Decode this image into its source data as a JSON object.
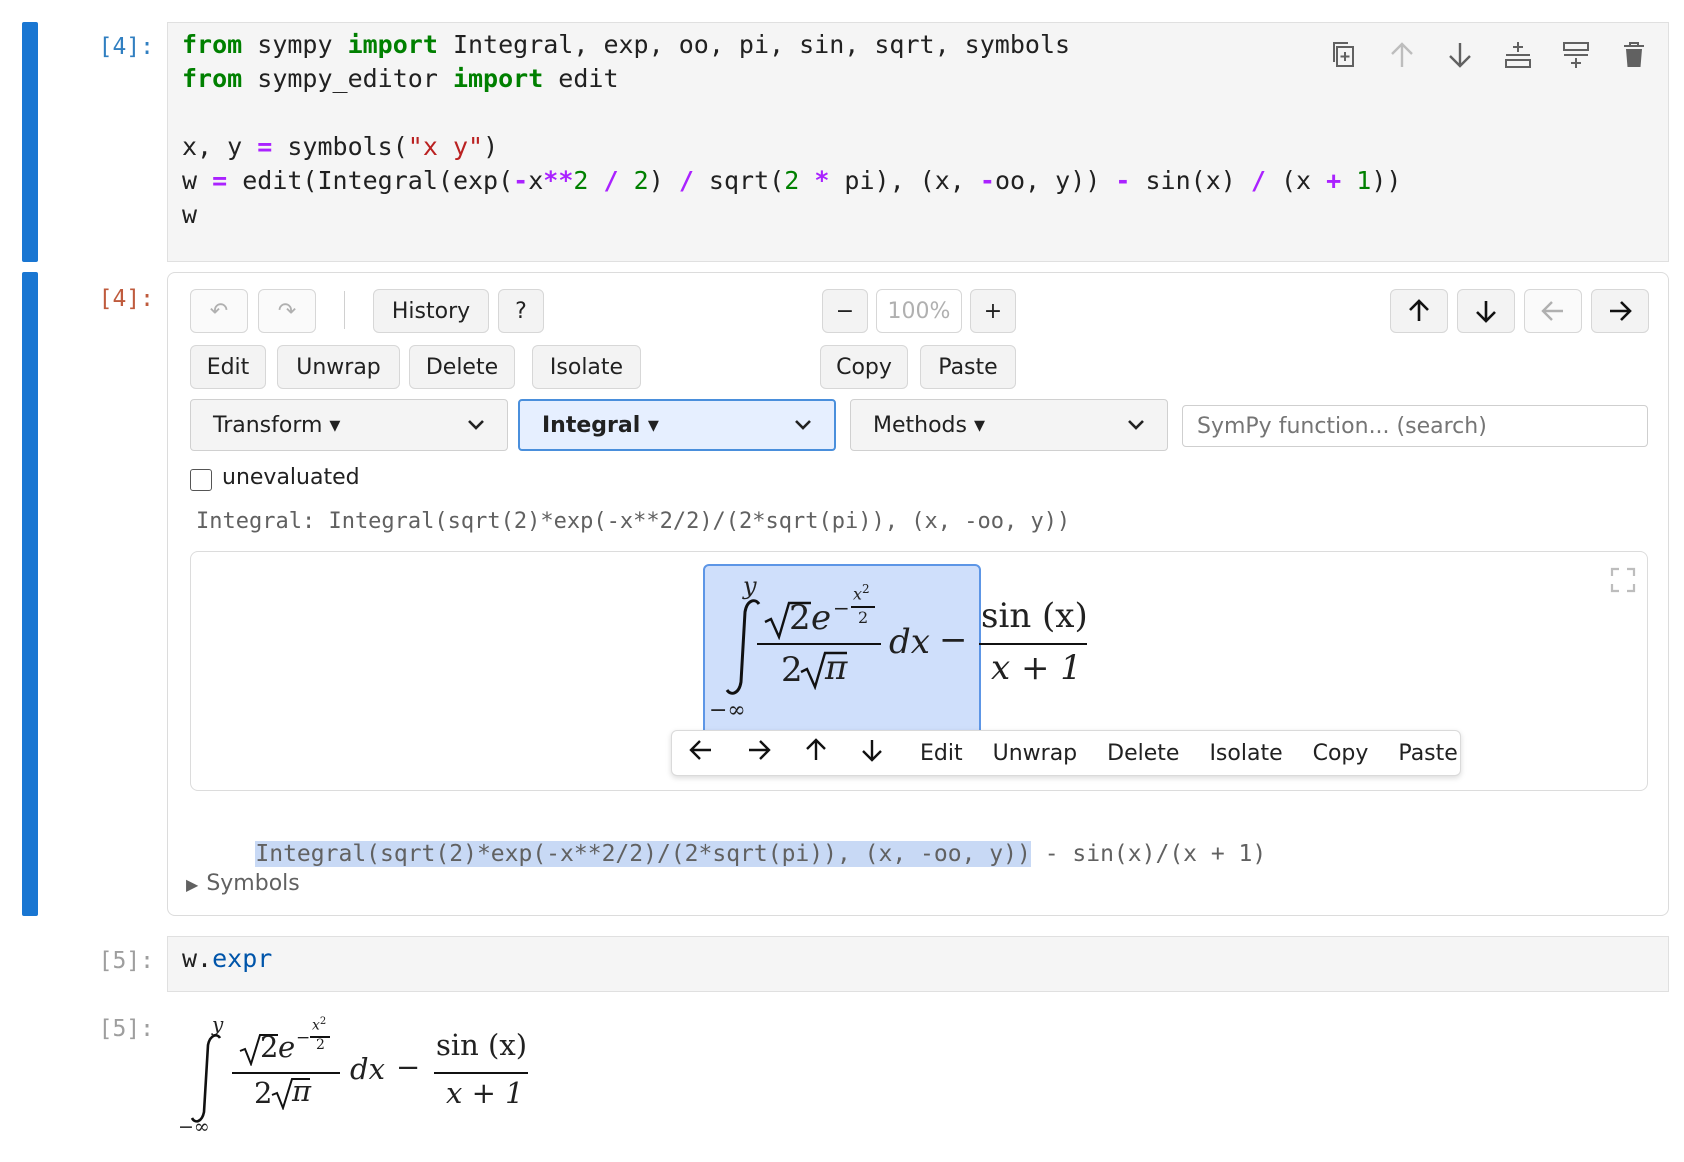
{
  "cells": [
    {
      "prompt": "[4]:",
      "code_lines": [
        [
          {
            "t": "from",
            "c": "kw"
          },
          {
            "t": " sympy "
          },
          {
            "t": "import",
            "c": "kw"
          },
          {
            "t": " Integral, exp, oo, pi, sin, sqrt, symbols"
          }
        ],
        [
          {
            "t": "from",
            "c": "kw"
          },
          {
            "t": " sympy_editor "
          },
          {
            "t": "import",
            "c": "kw"
          },
          {
            "t": " edit"
          }
        ],
        [],
        [
          {
            "t": "x, y "
          },
          {
            "t": "=",
            "c": "op"
          },
          {
            "t": " symbols("
          },
          {
            "t": "\"x y\"",
            "c": "str"
          },
          {
            "t": ")"
          }
        ],
        [
          {
            "t": "w "
          },
          {
            "t": "=",
            "c": "op"
          },
          {
            "t": " edit(Integral(exp("
          },
          {
            "t": "-",
            "c": "op"
          },
          {
            "t": "x"
          },
          {
            "t": "**",
            "c": "op"
          },
          {
            "t": "2",
            "c": "num"
          },
          {
            "t": " "
          },
          {
            "t": "/",
            "c": "op"
          },
          {
            "t": " "
          },
          {
            "t": "2",
            "c": "num"
          },
          {
            "t": ") "
          },
          {
            "t": "/",
            "c": "op"
          },
          {
            "t": " sqrt("
          },
          {
            "t": "2",
            "c": "num"
          },
          {
            "t": " "
          },
          {
            "t": "*",
            "c": "op"
          },
          {
            "t": " pi), (x, "
          },
          {
            "t": "-",
            "c": "op"
          },
          {
            "t": "oo, y)) "
          },
          {
            "t": "-",
            "c": "op"
          },
          {
            "t": " sin(x) "
          },
          {
            "t": "/",
            "c": "op"
          },
          {
            "t": " (x "
          },
          {
            "t": "+",
            "c": "op"
          },
          {
            "t": " "
          },
          {
            "t": "1",
            "c": "num"
          },
          {
            "t": "))"
          }
        ],
        [
          {
            "t": "w"
          }
        ]
      ]
    },
    {
      "prompt": "[5]:",
      "code_lines": [
        [
          {
            "t": "w."
          },
          {
            "t": "expr",
            "c": "attr"
          }
        ]
      ]
    }
  ],
  "output_prompt_4": "[4]:",
  "output_prompt_5": "[5]:",
  "editor": {
    "undo_label": "↶",
    "redo_label": "↷",
    "history_label": "History",
    "help_label": "?",
    "zoom_out_label": "−",
    "zoom_level": "100%",
    "zoom_in_label": "+",
    "edit_label": "Edit",
    "unwrap_label": "Unwrap",
    "delete_label": "Delete",
    "isolate_label": "Isolate",
    "copy_label": "Copy",
    "paste_label": "Paste",
    "transform_select": "Transform ▾",
    "integral_select": "Integral ▾",
    "methods_select": "Methods ▾",
    "search_placeholder": "SymPy function... (search)",
    "unevaluated_label": "unevaluated",
    "selection_info": "Integral: Integral(sqrt(2)*exp(-x**2/2)/(2*sqrt(pi)), (x, -oo, y))",
    "expr_selected": "Integral(sqrt(2)*exp(-x**2/2)/(2*sqrt(pi)), (x, -oo, y))",
    "expr_rest": " - sin(x)/(x + 1)",
    "symbols_label": "Symbols",
    "floating_toolbar": {
      "edit": "Edit",
      "unwrap": "Unwrap",
      "delete": "Delete",
      "isolate": "Isolate",
      "copy": "Copy",
      "paste": "Paste"
    }
  },
  "math": {
    "upper_limit": "y",
    "lower_limit": "−∞",
    "numerator_sqrt_arg": "2",
    "exp_base": "e",
    "exp_sign": "−",
    "exp_num": "x",
    "exp_num_pow": "2",
    "exp_den": "2",
    "den_coef": "2",
    "den_sqrt_arg": "π",
    "dx": "dx",
    "minus": "−",
    "frac2_num": "sin (x)",
    "frac2_den": "x + 1"
  },
  "colors": {
    "cell_bar": "#1976d2",
    "selection_fill": "#cfdffb",
    "selection_border": "#5d96e6",
    "text_selection": "#c8d9f5"
  }
}
